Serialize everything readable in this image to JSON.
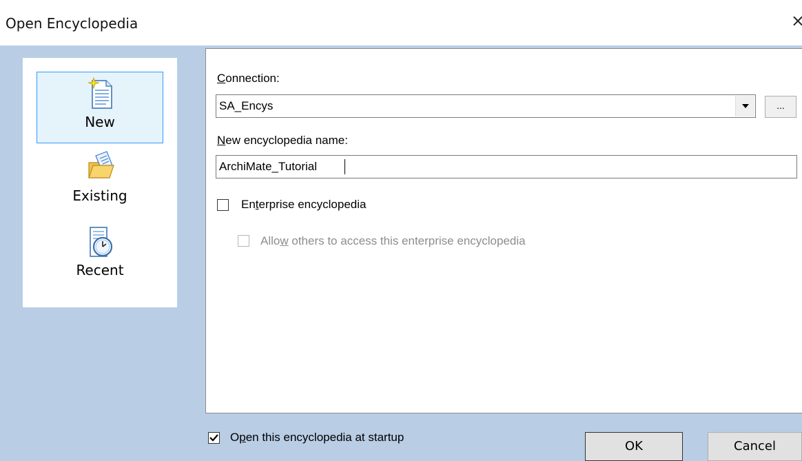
{
  "window": {
    "title": "Open Encyclopedia",
    "close_glyph": "×"
  },
  "nav": {
    "items": [
      {
        "label": "New",
        "icon": "new-document-icon",
        "selected": true
      },
      {
        "label": "Existing",
        "icon": "open-folder-icon",
        "selected": false
      },
      {
        "label": "Recent",
        "icon": "recent-clock-icon",
        "selected": false
      }
    ]
  },
  "form": {
    "connection": {
      "label_first": "C",
      "label_rest": "onnection:",
      "value": "SA_Encys",
      "browse_label": "..."
    },
    "name": {
      "label_first": "N",
      "label_rest": "ew encyclopedia name:",
      "value": "ArchiMate_Tutorial"
    },
    "enterprise": {
      "label_a": "En",
      "label_u": "t",
      "label_b": "erprise encyclopedia",
      "checked": false
    },
    "allow_others": {
      "label_a": "Allo",
      "label_u": "w",
      "label_b": " others to access this enterprise encyclopedia",
      "checked": false,
      "enabled": false
    }
  },
  "footer": {
    "startup": {
      "label_a": "O",
      "label_u": "p",
      "label_b": "en this encyclopedia at startup",
      "checked": true
    },
    "ok_label": "OK",
    "cancel_label": "Cancel"
  },
  "colors": {
    "client_bg": "#b9cde5",
    "selection_border": "#3399ff",
    "selection_bg": "#e5f3fb"
  }
}
